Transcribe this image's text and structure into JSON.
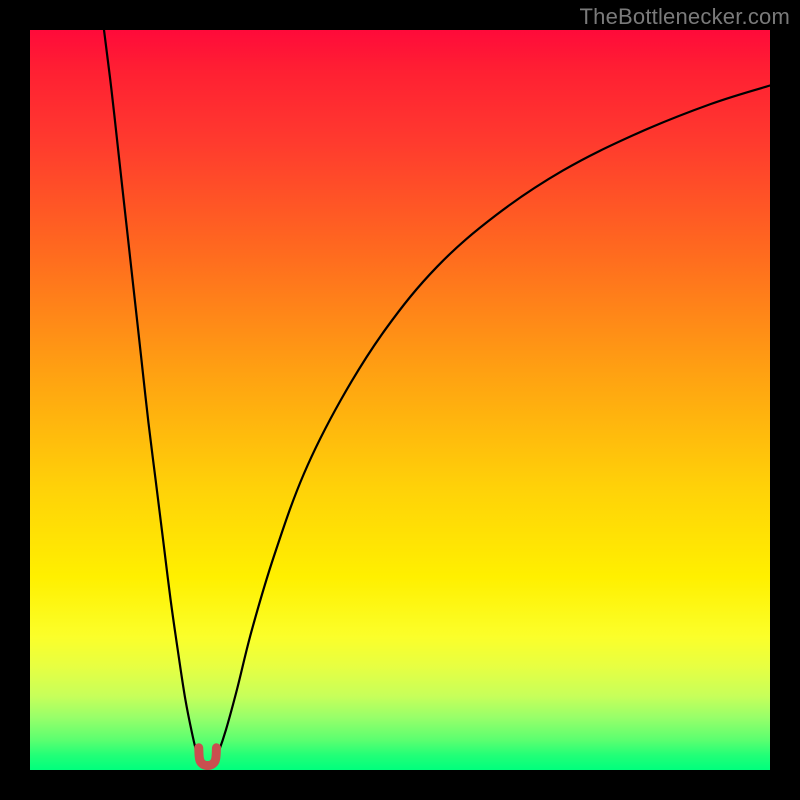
{
  "watermark": {
    "text": "TheBottlenecker.com"
  },
  "chart_data": {
    "type": "line",
    "title": "",
    "xlabel": "",
    "ylabel": "",
    "xlim": [
      0,
      100
    ],
    "ylim": [
      0,
      100
    ],
    "background_gradient": {
      "direction": "vertical",
      "stops": [
        {
          "pos": 0,
          "color": "#ff0a3a"
        },
        {
          "pos": 15,
          "color": "#ff3a2e"
        },
        {
          "pos": 30,
          "color": "#ff6a1f"
        },
        {
          "pos": 46,
          "color": "#ffa012"
        },
        {
          "pos": 62,
          "color": "#ffd208"
        },
        {
          "pos": 74,
          "color": "#fff000"
        },
        {
          "pos": 86,
          "color": "#e7ff42"
        },
        {
          "pos": 93,
          "color": "#96ff6a"
        },
        {
          "pos": 100,
          "color": "#00ff7d"
        }
      ]
    },
    "series": [
      {
        "name": "bottleneck-curve-left",
        "points": [
          {
            "x": 10.0,
            "y": 100.0
          },
          {
            "x": 11.0,
            "y": 92.0
          },
          {
            "x": 12.0,
            "y": 83.0
          },
          {
            "x": 13.0,
            "y": 74.0
          },
          {
            "x": 14.0,
            "y": 65.0
          },
          {
            "x": 15.0,
            "y": 56.0
          },
          {
            "x": 16.0,
            "y": 47.0
          },
          {
            "x": 17.0,
            "y": 39.0
          },
          {
            "x": 18.0,
            "y": 31.0
          },
          {
            "x": 19.0,
            "y": 23.0
          },
          {
            "x": 20.0,
            "y": 16.0
          },
          {
            "x": 21.0,
            "y": 9.5
          },
          {
            "x": 22.0,
            "y": 4.5
          },
          {
            "x": 22.5,
            "y": 2.5
          },
          {
            "x": 23.0,
            "y": 1.5
          }
        ]
      },
      {
        "name": "bottleneck-curve-right",
        "points": [
          {
            "x": 25.0,
            "y": 1.5
          },
          {
            "x": 25.5,
            "y": 2.5
          },
          {
            "x": 26.5,
            "y": 5.5
          },
          {
            "x": 28.0,
            "y": 11.0
          },
          {
            "x": 30.0,
            "y": 19.0
          },
          {
            "x": 33.0,
            "y": 29.0
          },
          {
            "x": 37.0,
            "y": 40.0
          },
          {
            "x": 42.0,
            "y": 50.0
          },
          {
            "x": 48.0,
            "y": 59.5
          },
          {
            "x": 55.0,
            "y": 68.0
          },
          {
            "x": 63.0,
            "y": 75.0
          },
          {
            "x": 72.0,
            "y": 81.0
          },
          {
            "x": 82.0,
            "y": 86.0
          },
          {
            "x": 92.0,
            "y": 90.0
          },
          {
            "x": 100.0,
            "y": 92.5
          }
        ]
      },
      {
        "name": "optimal-marker",
        "color": "#c94f4f",
        "stroke_width": 9,
        "points": [
          {
            "x": 22.8,
            "y": 3.0
          },
          {
            "x": 23.0,
            "y": 1.2
          },
          {
            "x": 24.0,
            "y": 0.6
          },
          {
            "x": 25.0,
            "y": 1.2
          },
          {
            "x": 25.2,
            "y": 3.0
          }
        ]
      }
    ]
  }
}
